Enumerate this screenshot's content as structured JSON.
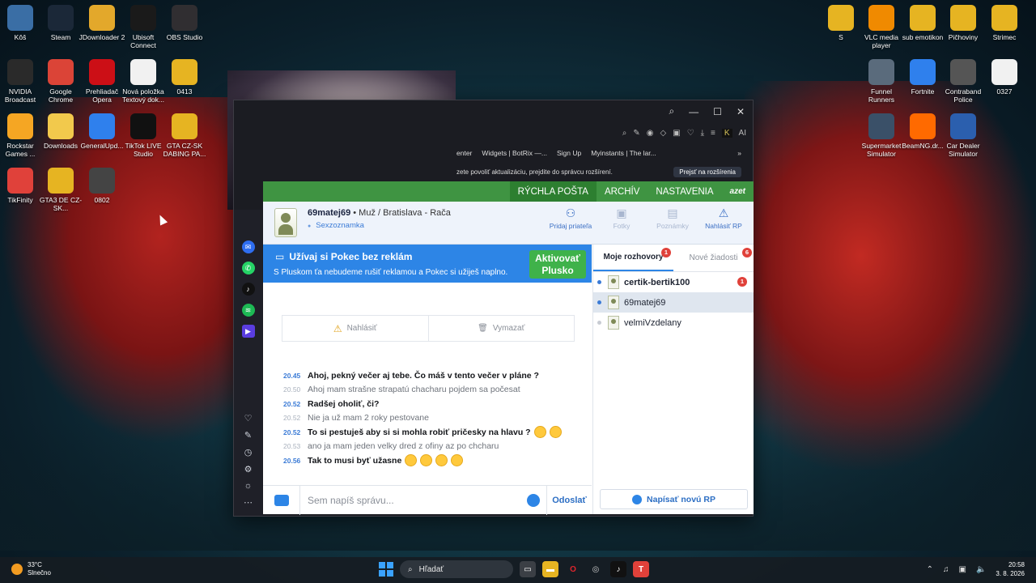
{
  "desktop": {
    "icons_left": [
      {
        "label": "Kôš",
        "icon": "recycle-bin-icon",
        "color": "#3a6ea5"
      },
      {
        "label": "Steam",
        "icon": "steam-icon",
        "color": "#1b2838"
      },
      {
        "label": "JDownloader 2",
        "icon": "jdownloader-icon",
        "color": "#e3a82b"
      },
      {
        "label": "Ubisoft Connect",
        "icon": "ubisoft-icon",
        "color": "#1a1a1a"
      },
      {
        "label": "OBS Studio",
        "icon": "obs-icon",
        "color": "#302e31"
      },
      {
        "label": "NVIDIA Broadcast",
        "icon": "nvidia-icon",
        "color": "#2a2a2a"
      },
      {
        "label": "Google Chrome",
        "icon": "chrome-icon",
        "color": "#db4437"
      },
      {
        "label": "Prehliadač Opera",
        "icon": "opera-icon",
        "color": "#cc0f16"
      },
      {
        "label": "Nová položka Textový dok...",
        "icon": "text-document-icon",
        "color": "#f1f1f1"
      },
      {
        "label": "0413",
        "icon": "folder-icon",
        "color": "#e6b422"
      },
      {
        "label": "Rockstar Games ...",
        "icon": "rockstar-icon",
        "color": "#f5a623"
      },
      {
        "label": "Downloads",
        "icon": "folder-icon",
        "color": "#f2c94c"
      },
      {
        "label": "GeneralUpd...",
        "icon": "shield-icon",
        "color": "#2f80ed"
      },
      {
        "label": "TikTok LIVE Studio",
        "icon": "tiktok-icon",
        "color": "#111111"
      },
      {
        "label": "GTA CZ-SK DABING PA...",
        "icon": "folder-icon",
        "color": "#e6b422"
      },
      {
        "label": "TikFinity",
        "icon": "tikfinity-icon",
        "color": "#e0413a"
      },
      {
        "label": "GTA3 DE CZ-SK...",
        "icon": "folder-icon",
        "color": "#e6b422"
      },
      {
        "label": "0802",
        "icon": "video-file-icon",
        "color": "#444444"
      }
    ],
    "icons_right": [
      {
        "label": "S",
        "icon": "folder-icon",
        "color": "#e6b422"
      },
      {
        "label": "VLC media player",
        "icon": "vlc-icon",
        "color": "#f08a00"
      },
      {
        "label": "sub emotikon",
        "icon": "folder-icon",
        "color": "#e6b422"
      },
      {
        "label": "Pičhoviny",
        "icon": "folder-icon",
        "color": "#e6b422"
      },
      {
        "label": "Strimec",
        "icon": "folder-icon",
        "color": "#e6b422"
      },
      {
        "label": "Funnel Runners",
        "icon": "game-icon",
        "color": "#5a6b7c"
      },
      {
        "label": "Fortnite",
        "icon": "fortnite-icon",
        "color": "#2f80ed"
      },
      {
        "label": "Contraband Police",
        "icon": "game-icon",
        "color": "#555555"
      },
      {
        "label": "0327",
        "icon": "video-file-icon",
        "color": "#f1f1f1"
      },
      {
        "label": "Supermarket Simulator",
        "icon": "game-icon",
        "color": "#3a5068"
      },
      {
        "label": "BeamNG.dr...",
        "icon": "beamng-icon",
        "color": "#ff6a00"
      },
      {
        "label": "Car Dealer Simulator",
        "icon": "game-icon",
        "color": "#2b5fae"
      }
    ]
  },
  "browser": {
    "bookmarks": [
      "enter",
      "Widgets | BotRix —...",
      "Sign Up",
      "Myinstants | The lar..."
    ],
    "notice_text": "zete povoliť aktualizáciu, prejdite do správcu rozšírení.",
    "notice_button": "Prejsť na rozšírenia",
    "toolbar_ai": "AI"
  },
  "pokec": {
    "nav": {
      "quick_mail": "RÝCHLA POŠTA",
      "archive": "ARCHÍV",
      "settings": "NASTAVENIA",
      "brand": "azet"
    },
    "user": {
      "name": "69matej69",
      "details": " • Muž / Bratislava - Rača",
      "section": "Sexzoznamka"
    },
    "actions": {
      "add_friend": "Pridaj priateľa",
      "photos": "Fotky",
      "notes": "Poznámky",
      "report": "Nahlásiť RP"
    },
    "promo": {
      "title": "Užívaj si Pokec bez reklám",
      "text": "S Pluskom ťa nebudeme rušiť reklamou a Pokec si užiješ naplno.",
      "cta_line1": "Aktivovať",
      "cta_line2": "Plusko"
    },
    "tool_buttons": {
      "report": "Nahlásiť",
      "delete": "Vymazať"
    },
    "messages": [
      {
        "time": "20.45",
        "text": "Ahoj, pekný večer aj tebe. Čo máš v tento večer v pláne ?",
        "mine": true,
        "emojis": 0
      },
      {
        "time": "20.50",
        "text": "Ahoj mam strašne strapatú chacharu pojdem sa počesat",
        "mine": false,
        "emojis": 0
      },
      {
        "time": "20.52",
        "text": "Radšej oholiť, či?",
        "mine": true,
        "emojis": 0
      },
      {
        "time": "20.52",
        "text": "Nie ja už mam 2 roky pestovane",
        "mine": false,
        "emojis": 0
      },
      {
        "time": "20.52",
        "text": "To si pestuješ aby si si mohla robiť pričesky na hlavu ?",
        "mine": true,
        "emojis": 2
      },
      {
        "time": "20.53",
        "text": "ano ja mam jeden velky dred z ofiny az po chcharu",
        "mine": false,
        "emojis": 0
      },
      {
        "time": "20.56",
        "text": "Tak to musi byť užasne",
        "mine": true,
        "emojis": 4
      }
    ],
    "composer": {
      "placeholder": "Sem napíš správu...",
      "send": "Odoslať"
    },
    "tabs": {
      "my_chats": "Moje rozhovory",
      "my_chats_badge": "1",
      "new_requests": "Nové žiadosti",
      "new_requests_badge": "6"
    },
    "conversations": [
      {
        "name": "certik-bertik100",
        "unread": "1",
        "bold": true,
        "selected": false,
        "online": true
      },
      {
        "name": "69matej69",
        "unread": "",
        "bold": false,
        "selected": true,
        "online": true
      },
      {
        "name": "velmiVzdelany",
        "unread": "",
        "bold": false,
        "selected": false,
        "online": false
      }
    ],
    "new_rp": "Napísať novú RP",
    "colors": {
      "green": "#3f9442",
      "blue": "#2d85e6",
      "badge": "#e0413a"
    }
  },
  "taskbar": {
    "temp": "33°C",
    "weather": "Slnečno",
    "search": "Hľadať",
    "time": "20:58",
    "date": "3. 8. 2026"
  }
}
